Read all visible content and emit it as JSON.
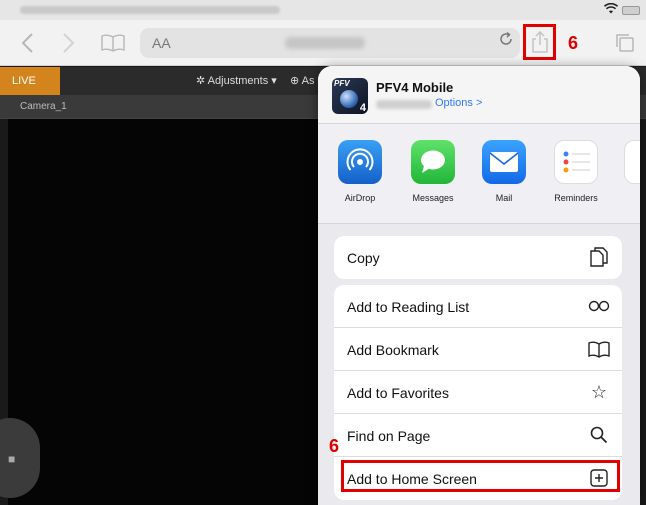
{
  "statusbar": {},
  "toolbar": {
    "address_prefix": "AA",
    "step_marker": "6"
  },
  "app": {
    "live_label": "LIVE",
    "adjustments_label": "Adjustments",
    "as_label": "As",
    "camera_tab": "Camera_1"
  },
  "share_sheet": {
    "app_name": "PFV4 Mobile",
    "options_label": "Options >",
    "app_icon_text": "PFV",
    "app_icon_num": "4",
    "share_apps": [
      {
        "label": "AirDrop",
        "icon": "airdrop-icon"
      },
      {
        "label": "Messages",
        "icon": "messages-icon"
      },
      {
        "label": "Mail",
        "icon": "mail-icon"
      },
      {
        "label": "Reminders",
        "icon": "reminders-icon"
      }
    ],
    "actions": {
      "copy": "Copy",
      "reading_list": "Add to Reading List",
      "bookmark": "Add Bookmark",
      "favorites": "Add to Favorites",
      "find": "Find on Page",
      "home_screen": "Add to Home Screen"
    },
    "step_marker": "6"
  },
  "colors": {
    "highlight": "#e00000",
    "link": "#3478f6",
    "live": "#d4841c"
  }
}
